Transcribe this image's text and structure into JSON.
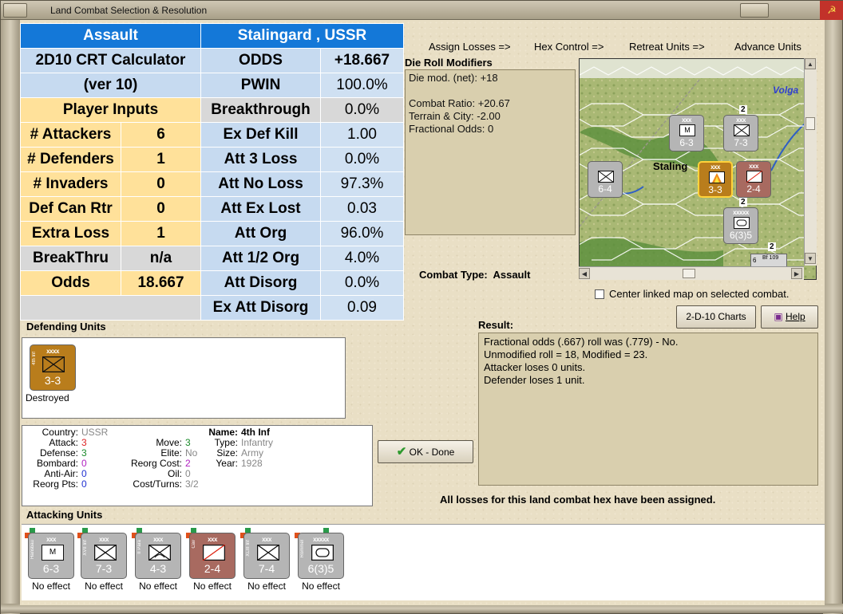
{
  "window": {
    "title": "Land Combat Selection & Resolution"
  },
  "crt": {
    "assault": "Assault",
    "location": "Stalingard , USSR",
    "calc_line1": "2D10 CRT Calculator",
    "calc_line2": "(ver 10)",
    "player_inputs": "Player Inputs",
    "inputs": [
      {
        "label": "# Attackers",
        "value": "6"
      },
      {
        "label": "# Defenders",
        "value": "1"
      },
      {
        "label": "# Invaders",
        "value": "0"
      },
      {
        "label": "Def Can Rtr",
        "value": "0"
      },
      {
        "label": "Extra Loss",
        "value": "1"
      },
      {
        "label": "BreakThru",
        "value": "n/a"
      },
      {
        "label": "Odds",
        "value": "18.667"
      }
    ],
    "outputs": [
      {
        "label": "ODDS",
        "value": "+18.667"
      },
      {
        "label": "PWIN",
        "value": "100.0%"
      },
      {
        "label": "Breakthrough",
        "value": "0.0%"
      },
      {
        "label": "Ex Def Kill",
        "value": "1.00"
      },
      {
        "label": "Att 3 Loss",
        "value": "0.0%"
      },
      {
        "label": "Att No Loss",
        "value": "97.3%"
      },
      {
        "label": "Att Ex Lost",
        "value": "0.03"
      },
      {
        "label": "Att Org",
        "value": "96.0%"
      },
      {
        "label": "Att 1/2 Org",
        "value": "4.0%"
      },
      {
        "label": "Att Disorg",
        "value": "0.0%"
      },
      {
        "label": "Ex Att Disorg",
        "value": "0.09"
      }
    ]
  },
  "menu": {
    "assign_losses": "Assign Losses =>",
    "hex_control": "Hex Control =>",
    "retreat_units": "Retreat Units =>",
    "advance_units": "Advance Units"
  },
  "die_roll": {
    "title": "Die Roll Modifiers",
    "lines": [
      "Die mod. (net): +18",
      "",
      "Combat Ratio: +20.67",
      "Terrain & City: -2.00",
      "Fractional Odds: 0"
    ]
  },
  "map": {
    "river_label": "Volga",
    "city_label": "Staling",
    "units": [
      {
        "size": "xxx",
        "str": "6-3",
        "sym": "M"
      },
      {
        "size": "xxx",
        "str": "7-3",
        "sym": ""
      },
      {
        "size": "",
        "str": "6-4",
        "sym": ""
      },
      {
        "size": "xxx",
        "str": "3-3",
        "sym": ""
      },
      {
        "size": "xxx",
        "str": "2-4",
        "sym": ""
      },
      {
        "size": "xxxxx",
        "str": "6(3)5",
        "sym": ""
      }
    ],
    "badges": [
      "2",
      "2",
      "2",
      "2"
    ],
    "corner_unit": "Bf 109",
    "corner_num": "6"
  },
  "combat_type": {
    "label": "Combat Type:",
    "value": "Assault"
  },
  "center_map": "Center linked map on selected combat.",
  "buttons": {
    "charts": "2-D-10 Charts",
    "help": "Help",
    "ok": "OK - Done"
  },
  "result": {
    "title": "Result:",
    "lines": [
      "Fractional odds (.667) roll was (.779)  - No.",
      "Unmodified roll = 18, Modified = 23.",
      "Attacker loses 0 units.",
      "Defender loses 1 unit."
    ]
  },
  "defending": {
    "title": "Defending Units",
    "unit": {
      "size": "xxxx",
      "side": "4th Inf",
      "str": "3-3",
      "status": "Destroyed"
    }
  },
  "info": {
    "country_k": "Country:",
    "country": "USSR",
    "attack_k": "Attack:",
    "attack": "3",
    "defense_k": "Defense:",
    "defense": "3",
    "bombard_k": "Bombard:",
    "bombard": "0",
    "antiair_k": "Anti-Air:",
    "antiair": "0",
    "reorg_k": "Reorg Pts:",
    "reorg": "0",
    "move_k": "Move:",
    "move": "3",
    "elite_k": "Elite:",
    "elite": "No",
    "reorgcost_k": "Reorg Cost:",
    "reorgcost": "2",
    "oil_k": "Oil:",
    "oil": "0",
    "cost_k": "Cost/Turns:",
    "cost": "3/2",
    "name_k": "Name:",
    "name": "4th Inf",
    "type_k": "Type:",
    "type": "Infantry",
    "size_k": "Size:",
    "size": "Army",
    "year_k": "Year:",
    "year": "1928"
  },
  "losses_msg": "All losses for this land combat hex have been assigned.",
  "attacking": {
    "title": "Attacking Units",
    "units": [
      {
        "size": "xxx",
        "side": "Hansbau",
        "str": "6-3",
        "sym": "M",
        "effect": "No effect"
      },
      {
        "size": "xxx",
        "side": "XVII Inf",
        "str": "7-3",
        "sym": "",
        "effect": "No effect"
      },
      {
        "size": "xxx",
        "side": "II Para",
        "str": "4-3",
        "sym": "",
        "effect": "No effect"
      },
      {
        "size": "xxx",
        "side": "Cav",
        "str": "2-4",
        "sym": "",
        "effect": "No effect"
      },
      {
        "size": "xxx",
        "side": "XLIII Inf",
        "str": "7-4",
        "sym": "",
        "effect": "No effect"
      },
      {
        "size": "xxxxx",
        "side": "Rommel",
        "str": "6(3)5",
        "sym": "",
        "effect": "No effect"
      }
    ]
  },
  "colors": {
    "header_blue": "#1478d8",
    "input_yellow": "#ffe19a",
    "defender_unit": "#b97d1c",
    "attacker_unit": "#b5b5b5",
    "hungarian_unit": "#a86a60"
  }
}
